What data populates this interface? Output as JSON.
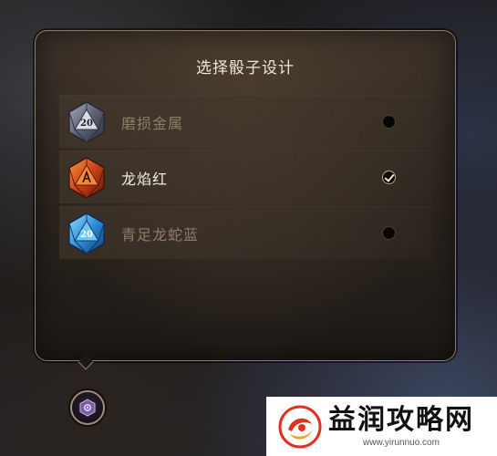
{
  "dialog": {
    "title": "选择骰子设计",
    "options": [
      {
        "label": "磨损金属",
        "die_number": "20",
        "selected": false,
        "die_style": "worn-metal",
        "color": "#8a8fa3"
      },
      {
        "label": "龙焰红",
        "die_number": "20",
        "selected": true,
        "die_style": "dragonflame-red",
        "color": "#d4501c"
      },
      {
        "label": "青足龙蛇蓝",
        "die_number": "20",
        "selected": false,
        "die_style": "azure-serpent-blue",
        "color": "#3aa0e0"
      }
    ]
  },
  "settings_button": {
    "icon": "dice-settings-icon"
  },
  "watermark": {
    "title": "益润攻略网",
    "url": "www.yirunnuo.com"
  },
  "colors": {
    "panel_border": "#8c7a63",
    "title_text": "#efe7da",
    "label_selected": "#f3ece2",
    "label_unselected": "#8f7d69"
  }
}
